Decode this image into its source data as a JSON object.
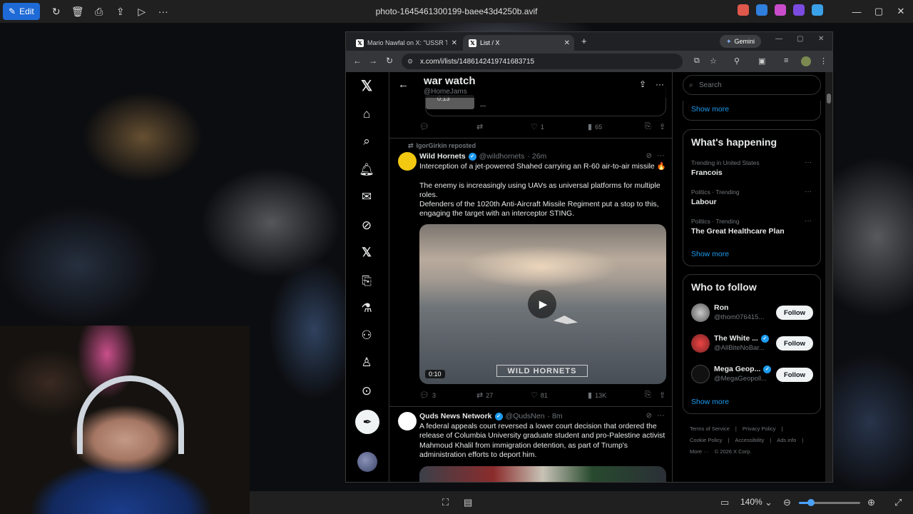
{
  "viewer": {
    "edit_label": "Edit",
    "file_name": "photo-1645461300199-baee43d4250b.avif",
    "zoom": "140%",
    "zoom_level": 0.2
  },
  "browser": {
    "tabs": [
      {
        "label": "Mario Nawfal on X: \"USSR TRUMP"
      },
      {
        "label": "List / X"
      }
    ],
    "new_tab": "+",
    "gemini": "Gemini",
    "url": "x.com/i/lists/1486142419741683715"
  },
  "header": {
    "title": "war watch",
    "handle": "@HomeJams"
  },
  "prev_post": {
    "video_time": "0:13",
    "ellipsis": "...",
    "replies": "",
    "reposts": "",
    "likes": "1",
    "views": "65"
  },
  "post1": {
    "reposted_by": "IgorGirkin reposted",
    "name": "Wild Hornets",
    "handle": "@wildhornets",
    "time": "· 26m",
    "text": "Interception of a jet-powered Shahed carrying an R-60 air-to-air missile 🔥\n\nThe enemy is increasingly using UAVs as universal platforms for multiple roles.\nDefenders of the 1020th Anti-Aircraft Missile Regiment put a stop to this, engaging the target with an interceptor STING.",
    "video_time": "0:10",
    "watermark": "WILD HORNETS",
    "replies": "3",
    "reposts": "27",
    "likes": "81",
    "views": "13K"
  },
  "post2": {
    "name": "Quds News Network",
    "handle": "@QudsNen",
    "time": "· 8m",
    "text": "A federal appeals court reversed a lower court decision that ordered the release of Columbia University graduate student and pro-Palestine activist Mahmoud Khalil from immigration detention, as part of Trump's administration efforts to deport him."
  },
  "sidebar": {
    "search_placeholder": "Search",
    "show_more": "Show more",
    "happening_title": "What's happening",
    "trends": [
      {
        "context": "Trending in United States",
        "name": "Francois"
      },
      {
        "context": "Politics · Trending",
        "name": "Labour"
      },
      {
        "context": "Politics · Trending",
        "name": "The Great Healthcare Plan"
      }
    ],
    "who_title": "Who to follow",
    "follow_label": "Follow",
    "who": [
      {
        "name": "Ron",
        "handle": "@thom076415..."
      },
      {
        "name": "The White ...",
        "handle": "@AllBiteNoBar..."
      },
      {
        "name": "Mega Geop...",
        "handle": "@MegaGeopoll..."
      }
    ],
    "footer": [
      "Terms of Service",
      "Privacy Policy",
      "Cookie Policy",
      "Accessibility",
      "Ads info",
      "More ···",
      "© 2026 X Corp."
    ]
  }
}
